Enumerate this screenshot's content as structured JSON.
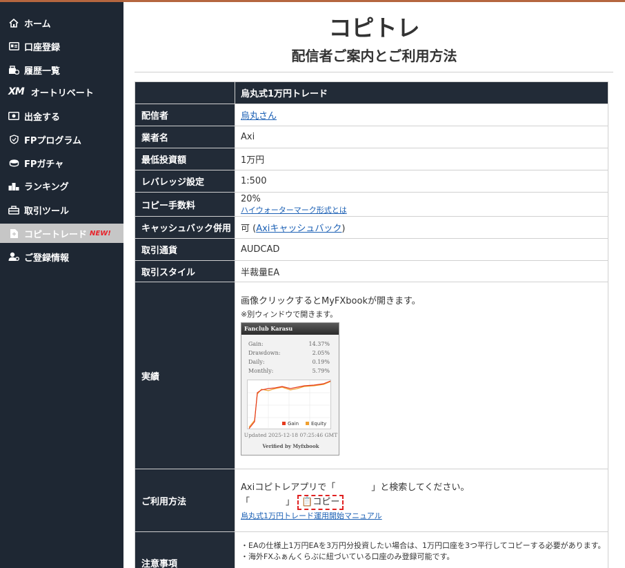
{
  "nav": {
    "items": [
      {
        "label": "ホーム",
        "icon": "home-icon"
      },
      {
        "label": "口座登録",
        "icon": "id-card-icon"
      },
      {
        "label": "履歴一覧",
        "icon": "history-icon"
      },
      {
        "label": "オートリベート",
        "icon": "xm-logo",
        "logo": "XM"
      },
      {
        "label": "出金する",
        "icon": "money-icon"
      },
      {
        "label": "FPプログラム",
        "icon": "shield-icon"
      },
      {
        "label": "FPガチャ",
        "icon": "coins-icon"
      },
      {
        "label": "ランキング",
        "icon": "podium-icon"
      },
      {
        "label": "取引ツール",
        "icon": "toolbox-icon"
      },
      {
        "label": "コピートレード",
        "icon": "copy-file-icon",
        "badge": "NEW!",
        "active": true
      },
      {
        "label": "ご登録情報",
        "icon": "user-gear-icon"
      }
    ]
  },
  "page": {
    "title": "コピトレ",
    "subtitle": "配信者ご案内とご利用方法"
  },
  "table": {
    "header_value": "烏丸式1万円トレード",
    "distributor_key": "配信者",
    "distributor_link": "烏丸さん",
    "broker_key": "業者名",
    "broker_value": "Axi",
    "min_invest_key": "最低投資額",
    "min_invest_value": "1万円",
    "leverage_key": "レバレッジ設定",
    "leverage_value": "1:500",
    "fee_key": "コピー手数料",
    "fee_value": "20%",
    "fee_link": "ハイウォーターマーク形式とは",
    "cashback_key": "キャッシュバック併用",
    "cashback_prefix": "可 (",
    "cashback_link": "Axiキャッシュバック",
    "cashback_suffix": ")",
    "currency_key": "取引通貨",
    "currency_value": "AUDCAD",
    "style_key": "取引スタイル",
    "style_value": "半裁量EA",
    "results_key": "実績",
    "results_text": "画像クリックするとMyFXbookが開きます。",
    "results_note": "※別ウィンドウで開きます。",
    "usage_key": "ご利用方法",
    "usage_line": "Axiコピトレアプリで「　　　　」と検索してください。",
    "usage_quote": "「　　　　」",
    "copy_button": "📋コピー",
    "manual_link": "烏丸式1万円トレード運用開始マニュアル",
    "notes_key": "注意事項",
    "notes": [
      "・EAの仕様上1万円EAを3万円分投資したい場合は、1万円口座を3つ平行してコピーする必要があります。",
      "・海外FXふぁんくらぶに紐づいている口座のみ登録可能です。"
    ]
  },
  "widget": {
    "name": "Fanclub Karasu",
    "stats": [
      {
        "label": "Gain:",
        "value": "14.37%"
      },
      {
        "label": "Drawdown:",
        "value": "2.05%"
      },
      {
        "label": "Daily:",
        "value": "0.19%"
      },
      {
        "label": "Monthly:",
        "value": "5.79%"
      }
    ],
    "legend_gain": "Gain",
    "legend_equity": "Equity",
    "updated": "Updated 2025-12-18 07:25:46 GMT",
    "verified": "Verified by Myfxbook",
    "colors": {
      "gain": "#e53a1d",
      "equity": "#f0a030"
    }
  }
}
